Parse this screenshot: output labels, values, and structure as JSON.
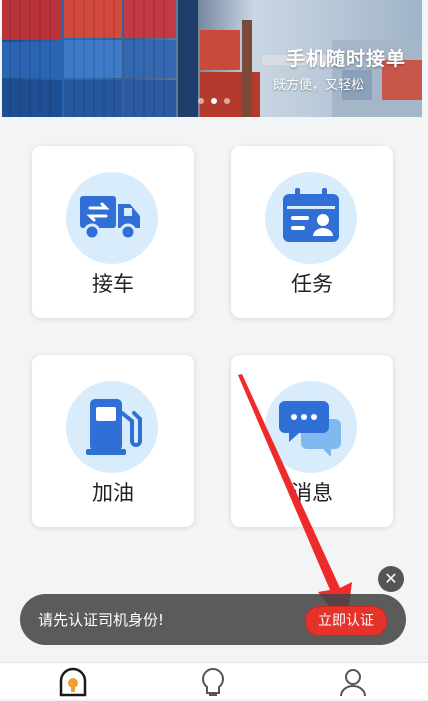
{
  "banner": {
    "title": "手机随时接单",
    "subtitle": "既方便，又轻松",
    "active_slide": 2,
    "slide_count": 3
  },
  "menu": {
    "items": [
      {
        "label": "接车",
        "icon": "truck-icon"
      },
      {
        "label": "任务",
        "icon": "task-card-icon"
      },
      {
        "label": "加油",
        "icon": "fuel-pump-icon"
      },
      {
        "label": "消息",
        "icon": "chat-bubble-icon"
      }
    ]
  },
  "toast": {
    "message": "请先认证司机身份!",
    "action_label": "立即认证",
    "close_icon": "close-icon"
  },
  "bottom_nav": {
    "items": [
      {
        "icon": "home-icon",
        "active": true
      },
      {
        "icon": "lightbulb-icon",
        "active": false
      },
      {
        "icon": "user-icon",
        "active": false
      }
    ]
  },
  "colors": {
    "accent": "#2f6fd6",
    "icon_bg": "#d8ecfb",
    "action_red": "#e5332a",
    "nav_active": "#f0a030"
  }
}
